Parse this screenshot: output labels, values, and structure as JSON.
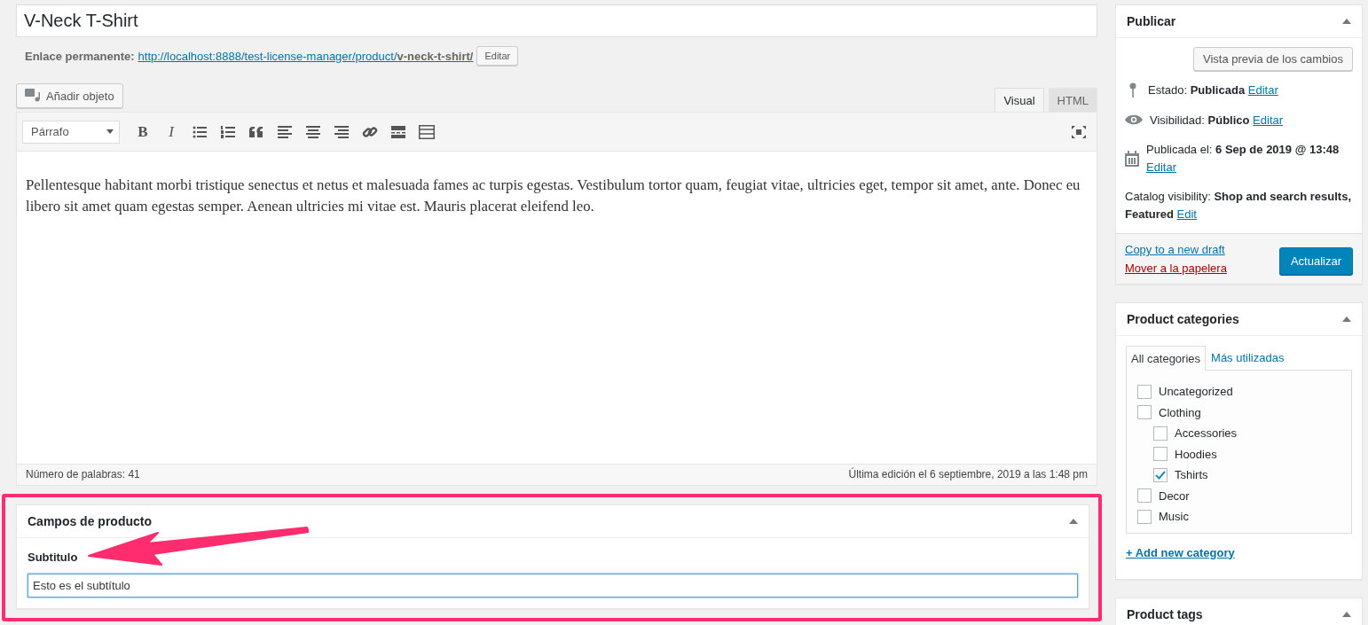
{
  "title_field": {
    "value": "V-Neck T-Shirt"
  },
  "permalink": {
    "label": "Enlace permanente:",
    "url": "http://localhost:8888/test-license-manager/product/",
    "url_slug": "v-neck-t-shirt/",
    "button": "Editar"
  },
  "add_media_button": "Añadir objeto",
  "editor_tabs": [
    {
      "label": "Visual",
      "selected": true
    },
    {
      "label": "HTML",
      "selected": false
    }
  ],
  "format_select": "Párrafo",
  "toolbar": [
    {
      "kind": "bold",
      "label": "B"
    },
    {
      "kind": "italic",
      "label": "I"
    },
    {
      "kind": "bullet-list"
    },
    {
      "kind": "number-list"
    },
    {
      "kind": "quote"
    },
    {
      "kind": "align-left"
    },
    {
      "kind": "align-center"
    },
    {
      "kind": "align-right"
    },
    {
      "kind": "link"
    },
    {
      "kind": "more"
    },
    {
      "kind": "kitchen-sink"
    }
  ],
  "content": "Pellentesque habitant morbi tristique senectus et netus et malesuada fames ac turpis egestas. Vestibulum tortor quam, feugiat vitae, ultricies eget, tempor sit amet, ante. Donec eu libero sit amet quam egestas semper. Aenean ultricies mi vitae est. Mauris placerat eleifend leo.",
  "word_count": "Número de palabras: 41",
  "last_edit": "Última edición el 6 septiembre, 2019 a las 1:48 pm",
  "product_fields": {
    "title": "Campos de producto",
    "field_label": "Subtitulo",
    "value": "Esto es el subtítulo"
  },
  "publish": {
    "title": "Publicar",
    "preview_button": "Vista previa de los cambios",
    "rows": [
      {
        "kind": "status",
        "text": "Estado: **Publicada**",
        "link": "Editar"
      },
      {
        "kind": "visibility",
        "text": "Visibilidad: **Público**",
        "link": "Editar"
      },
      {
        "kind": "date",
        "text": "Publicada el: **6 Sep de 2019 @ 13:48**",
        "link": "Editar"
      },
      {
        "kind": "catalog",
        "text": "Catalog visibility: **Shop and search results, Featured**",
        "link": "Edit"
      }
    ],
    "copy_link": "Copy to a new draft",
    "trash_link": "Mover a la papelera",
    "update_button": "Actualizar"
  },
  "categories": {
    "title": "Product categories",
    "tabs": [
      {
        "label": "All categories",
        "selected": true
      },
      {
        "label": "Más utilizadas",
        "selected": false
      }
    ],
    "items": [
      {
        "label": "Uncategorized",
        "checked": false
      },
      {
        "label": "Clothing",
        "checked": false,
        "children": [
          {
            "label": "Accessories",
            "checked": false
          },
          {
            "label": "Hoodies",
            "checked": false
          },
          {
            "label": "Tshirts",
            "checked": true
          }
        ]
      },
      {
        "label": "Decor",
        "checked": false
      },
      {
        "label": "Music",
        "checked": false
      }
    ],
    "add_link": "+ Add new category"
  },
  "tags": {
    "title": "Product tags"
  }
}
